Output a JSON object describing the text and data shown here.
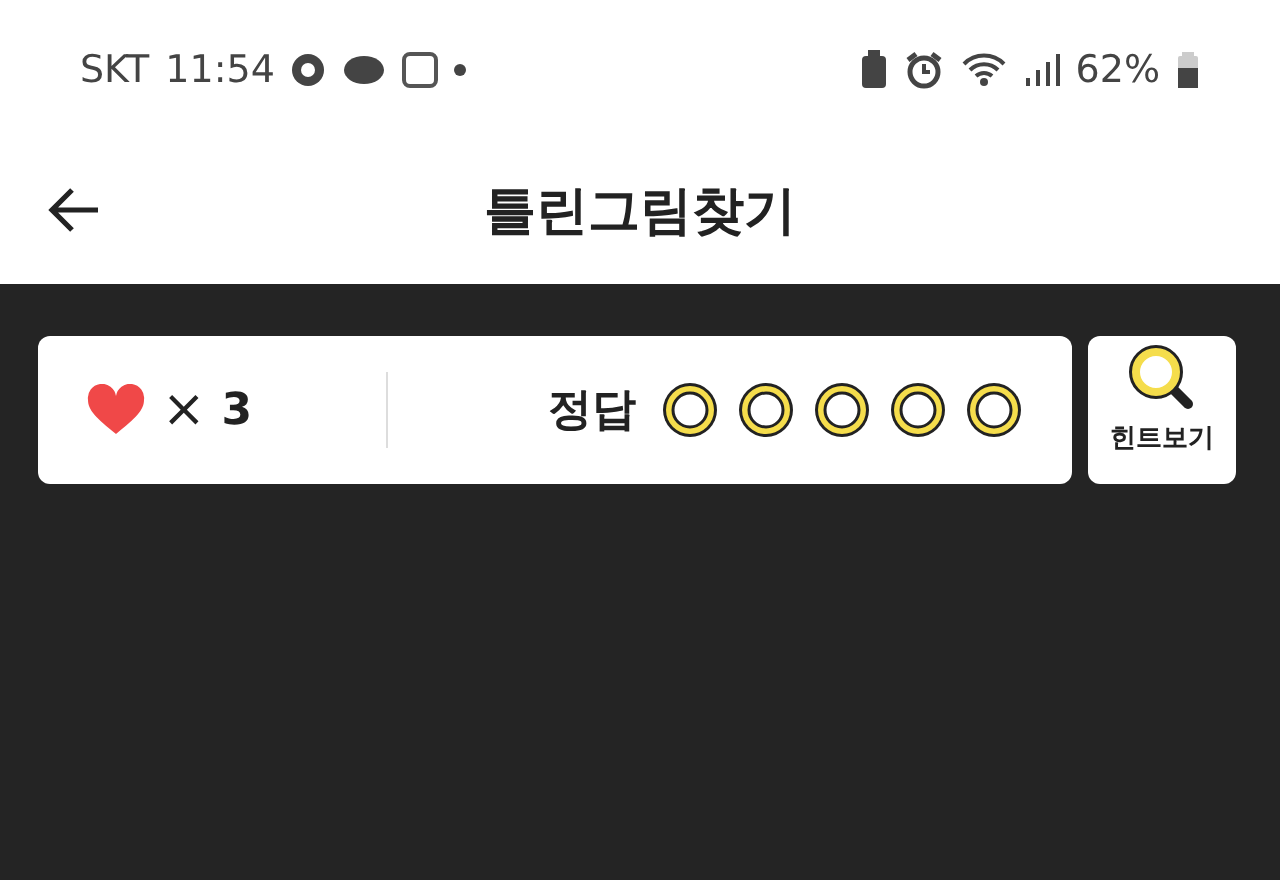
{
  "status_bar": {
    "carrier": "SKT",
    "time": "11:54",
    "battery": "62%"
  },
  "header": {
    "title": "틀린그림찾기"
  },
  "score": {
    "times": "×",
    "lives": "3",
    "answer_label": "정답",
    "answers": [
      {
        "found": false
      },
      {
        "found": false
      },
      {
        "found": false
      },
      {
        "found": false
      },
      {
        "found": false
      }
    ]
  },
  "hint_button": {
    "label": "힌트보기"
  }
}
